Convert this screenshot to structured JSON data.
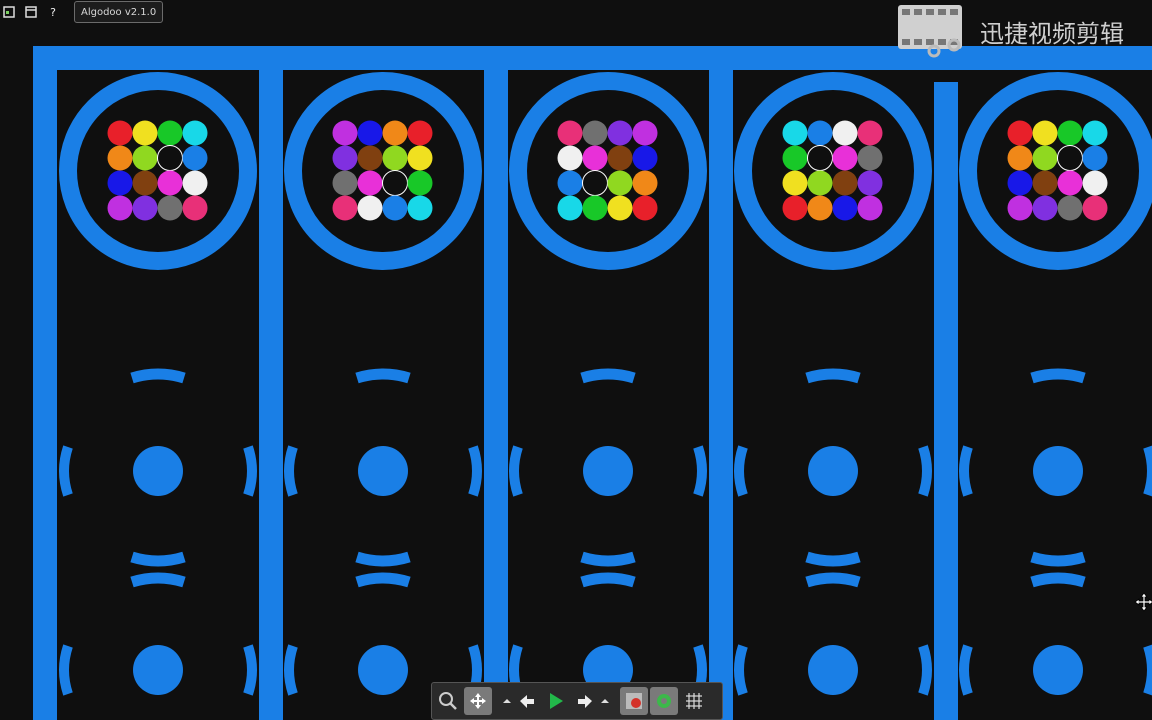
{
  "app": {
    "title": "Algodoo v2.1.0"
  },
  "topbar": {
    "buttons": [
      {
        "icon": "window-icon"
      },
      {
        "icon": "panel-icon"
      },
      {
        "label": "?",
        "icon": "help-icon"
      }
    ]
  },
  "watermark": {
    "text": "迅捷视频剪辑",
    "icon": "film-scissors-icon"
  },
  "scene": {
    "background": "#0f0f0f",
    "shape_color": "#1a7fe6",
    "columns": 5,
    "ball_colors": [
      [
        "#e8202a",
        "#f0e020",
        "#18c828",
        "#18d8e8",
        "#f08818",
        "#90d820",
        "#0f0f0f",
        "#1a7fe6",
        "#1818e8",
        "#804010",
        "#e830d8",
        "#f0f0f0",
        "#c030e0",
        "#8030e0",
        "#707070",
        "#e83078"
      ],
      [
        "#c030e0",
        "#1818e8",
        "#f08818",
        "#e8202a",
        "#8030e0",
        "#804010",
        "#90d820",
        "#f0e020",
        "#707070",
        "#e830d8",
        "#0f0f0f",
        "#18c828",
        "#e83078",
        "#f0f0f0",
        "#1a7fe6",
        "#18d8e8"
      ],
      [
        "#e83078",
        "#707070",
        "#8030e0",
        "#c030e0",
        "#f0f0f0",
        "#e830d8",
        "#804010",
        "#1818e8",
        "#1a7fe6",
        "#0f0f0f",
        "#90d820",
        "#f08818",
        "#18d8e8",
        "#18c828",
        "#f0e020",
        "#e8202a"
      ],
      [
        "#18d8e8",
        "#1a7fe6",
        "#f0f0f0",
        "#e83078",
        "#18c828",
        "#0f0f0f",
        "#e830d8",
        "#707070",
        "#f0e020",
        "#90d820",
        "#804010",
        "#8030e0",
        "#e8202a",
        "#f08818",
        "#1818e8",
        "#c030e0"
      ],
      [
        "#e8202a",
        "#f0e020",
        "#18c828",
        "#18d8e8",
        "#f08818",
        "#90d820",
        "#0f0f0f",
        "#1a7fe6",
        "#1818e8",
        "#804010",
        "#e830d8",
        "#f0f0f0",
        "#c030e0",
        "#8030e0",
        "#707070",
        "#e83078"
      ]
    ]
  },
  "toolbar": {
    "tools": [
      {
        "icon": "zoom-icon"
      },
      {
        "icon": "pan-icon"
      },
      {
        "icon": "dropdown-arrow-icon"
      },
      {
        "icon": "undo-icon"
      },
      {
        "icon": "play-icon"
      },
      {
        "icon": "redo-icon"
      },
      {
        "icon": "dropdown-arrow-icon"
      },
      {
        "icon": "scene-icon"
      },
      {
        "icon": "gear-tool-icon"
      },
      {
        "icon": "grid-icon"
      }
    ]
  }
}
